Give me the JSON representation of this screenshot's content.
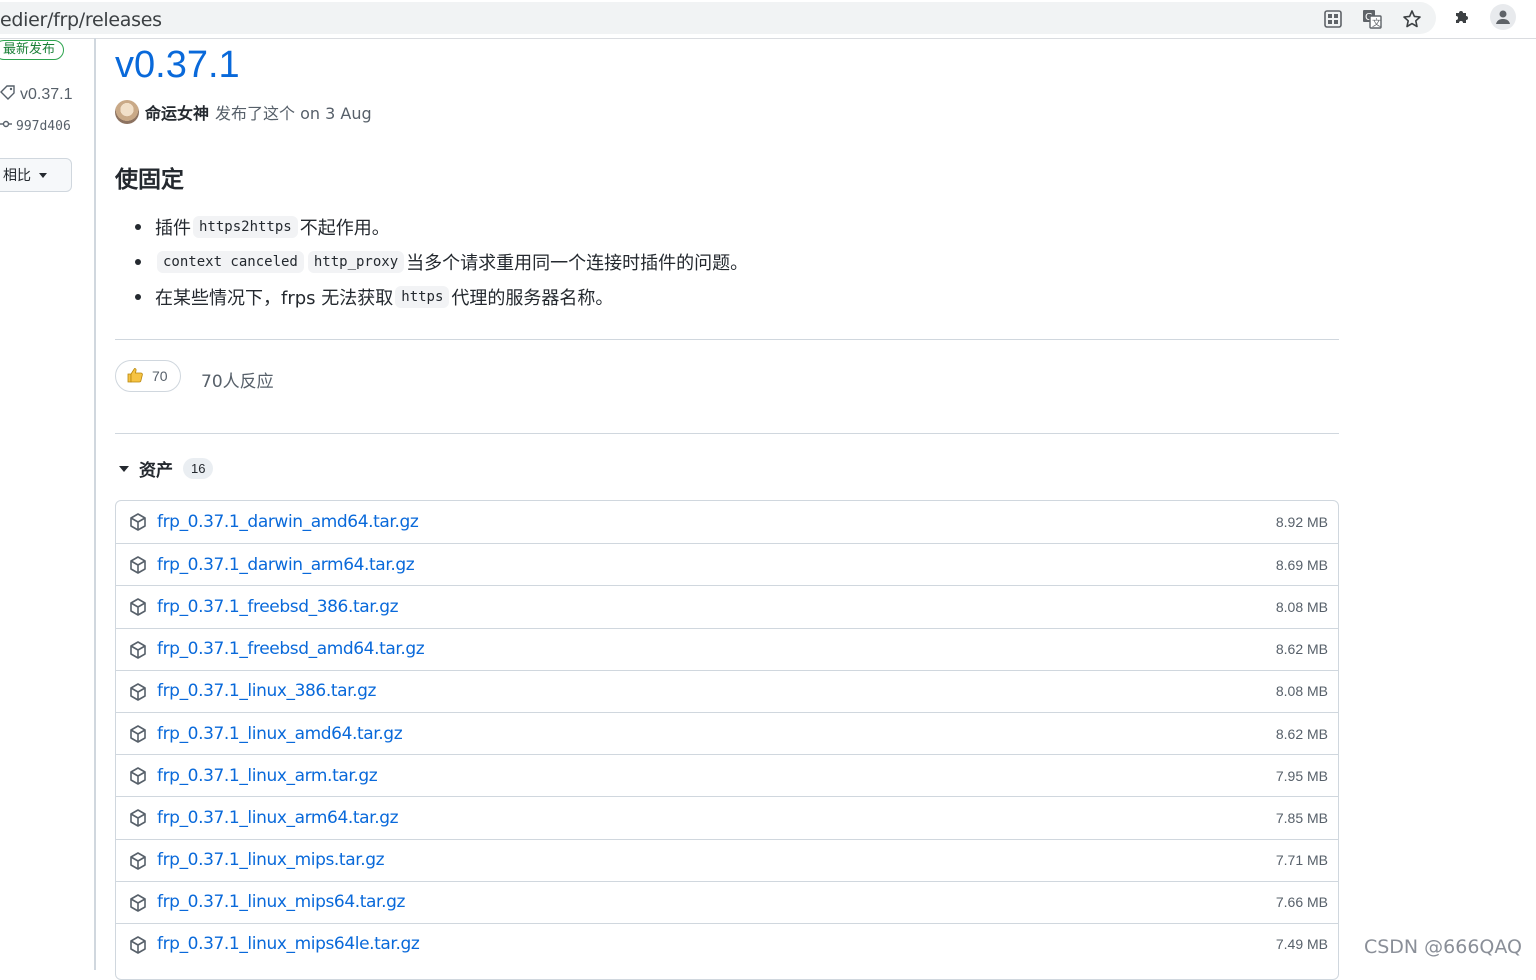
{
  "browser": {
    "url": "edier/frp/releases",
    "icons": [
      "qr-code-icon",
      "translate-icon",
      "star-icon",
      "extensions-icon",
      "profile-icon"
    ]
  },
  "sidebar": {
    "latest_label": "最新发布",
    "tag": "v0.37.1",
    "commit": "997d406",
    "compare_label": "相比"
  },
  "release": {
    "title": "v0.37.1",
    "author": "命运女神",
    "published_text": "发布了这个 on 3 Aug",
    "section_heading": "使固定",
    "notes": [
      {
        "pre": "插件",
        "code1": "https2https",
        "code2": "",
        "post": "不起作用。"
      },
      {
        "pre": "",
        "code1": "context canceled",
        "code2": "http_proxy",
        "post": "当多个请求重用同一个连接时插件的问题。"
      },
      {
        "pre": "在某些情况下，frps 无法获取",
        "code1": "https",
        "code2": "",
        "post": "代理的服务器名称。"
      }
    ],
    "reactions": {
      "count": "70",
      "summary": "70人反应"
    }
  },
  "assets": {
    "title": "资产",
    "count": "16",
    "items": [
      {
        "name": "frp_0.37.1_darwin_amd64.tar.gz",
        "size": "8.92 MB"
      },
      {
        "name": "frp_0.37.1_darwin_arm64.tar.gz",
        "size": "8.69 MB"
      },
      {
        "name": "frp_0.37.1_freebsd_386.tar.gz",
        "size": "8.08 MB"
      },
      {
        "name": "frp_0.37.1_freebsd_amd64.tar.gz",
        "size": "8.62 MB"
      },
      {
        "name": "frp_0.37.1_linux_386.tar.gz",
        "size": "8.08 MB"
      },
      {
        "name": "frp_0.37.1_linux_amd64.tar.gz",
        "size": "8.62 MB"
      },
      {
        "name": "frp_0.37.1_linux_arm.tar.gz",
        "size": "7.95 MB"
      },
      {
        "name": "frp_0.37.1_linux_arm64.tar.gz",
        "size": "7.85 MB"
      },
      {
        "name": "frp_0.37.1_linux_mips.tar.gz",
        "size": "7.71 MB"
      },
      {
        "name": "frp_0.37.1_linux_mips64.tar.gz",
        "size": "7.66 MB"
      },
      {
        "name": "frp_0.37.1_linux_mips64le.tar.gz",
        "size": "7.49 MB"
      }
    ]
  },
  "watermark": "CSDN @666QAQ",
  "colors": {
    "link": "#0969da",
    "border": "#d0d7de",
    "muted": "#57606a",
    "badge_green": "#1a7f37"
  }
}
